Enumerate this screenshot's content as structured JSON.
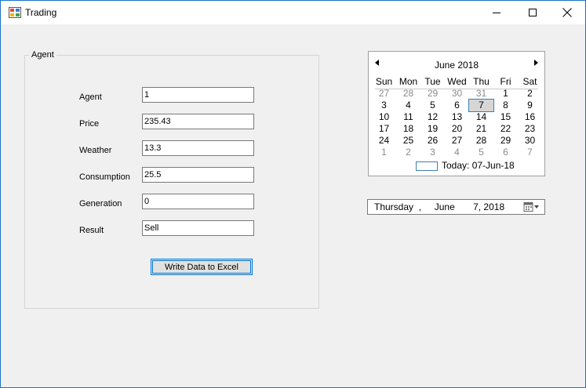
{
  "window": {
    "title": "Trading"
  },
  "group": {
    "legend": "Agent",
    "fields": [
      {
        "label": "Agent",
        "value": "1"
      },
      {
        "label": "Price",
        "value": "235.43"
      },
      {
        "label": "Weather",
        "value": "13.3"
      },
      {
        "label": "Consumption",
        "value": "25.5"
      },
      {
        "label": "Generation",
        "value": "0"
      },
      {
        "label": "Result",
        "value": "Sell"
      }
    ],
    "button_label": "Write Data to Excel"
  },
  "calendar": {
    "month_title": "June 2018",
    "weekdays": [
      "Sun",
      "Mon",
      "Tue",
      "Wed",
      "Thu",
      "Fri",
      "Sat"
    ],
    "weeks": [
      [
        "27",
        "28",
        "29",
        "30",
        "31",
        "1",
        "2"
      ],
      [
        "3",
        "4",
        "5",
        "6",
        "7",
        "8",
        "9"
      ],
      [
        "10",
        "11",
        "12",
        "13",
        "14",
        "15",
        "16"
      ],
      [
        "17",
        "18",
        "19",
        "20",
        "21",
        "22",
        "23"
      ],
      [
        "24",
        "25",
        "26",
        "27",
        "28",
        "29",
        "30"
      ],
      [
        "1",
        "2",
        "3",
        "4",
        "5",
        "6",
        "7"
      ]
    ],
    "selected_day": "7",
    "today_text": "Today: 07-Jun-18"
  },
  "date_picker": {
    "weekday": "Thursday",
    "sep": ",",
    "month": "June",
    "day_year": "7, 2018"
  },
  "colors": {
    "accent": "#0078d7",
    "window_bg": "#f0f0f0"
  }
}
